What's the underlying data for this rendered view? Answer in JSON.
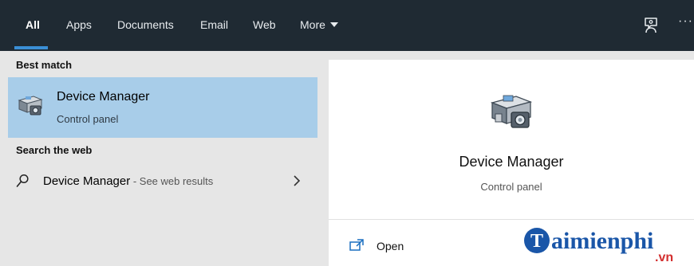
{
  "tabs": [
    {
      "label": "All",
      "active": true
    },
    {
      "label": "Apps",
      "active": false
    },
    {
      "label": "Documents",
      "active": false
    },
    {
      "label": "Email",
      "active": false
    },
    {
      "label": "Web",
      "active": false
    },
    {
      "label": "More",
      "active": false
    }
  ],
  "toolbar": {
    "feedback_icon": "feedback-icon",
    "more_options": "···"
  },
  "left": {
    "best_match_heading": "Best match",
    "best_match": {
      "title": "Device Manager",
      "subtitle": "Control panel",
      "icon": "device-manager-icon"
    },
    "web_heading": "Search the web",
    "web_result": {
      "title": "Device Manager",
      "suffix": " - See web results",
      "icon": "search-icon"
    }
  },
  "detail": {
    "title": "Device Manager",
    "subtitle": "Control panel",
    "icon": "device-manager-icon"
  },
  "actions": [
    {
      "label": "Open",
      "icon": "open-window-icon"
    }
  ],
  "watermark": {
    "main": "aimienphi",
    "sub": ".vn",
    "logo_letter": "T"
  },
  "colors": {
    "topbar": "#1f2a33",
    "accent": "#3a8fd6",
    "selection": "#a8cde9",
    "watermark": "#1a56a8",
    "watermark_sub": "#d32f2f"
  }
}
